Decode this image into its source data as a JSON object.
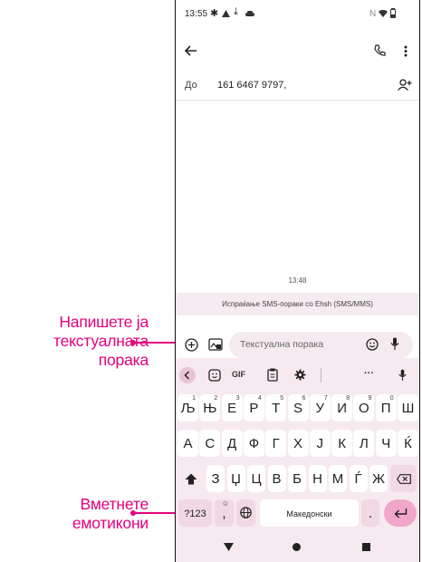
{
  "annotations": {
    "write_message": [
      "Напишете ја",
      "текстуалната",
      "порака"
    ],
    "insert_emoticons": [
      "Вметнете",
      "емотикони"
    ]
  },
  "status_bar": {
    "time": "13:55",
    "nfc": "N"
  },
  "app_bar": {
    "back_icon": "arrow-left-icon",
    "call_icon": "phone-icon",
    "more_icon": "more-vert-icon"
  },
  "recipient": {
    "label": "До",
    "number": "161 6467 9797,",
    "add_icon": "person-add-icon"
  },
  "conversation": {
    "timestamp": "13:48",
    "sending_via": "Испраќање SMS-пораки со Ehsh (SMS/MMS)"
  },
  "composer": {
    "placeholder": "Текстуална порака"
  },
  "keyboard": {
    "toolbar": {
      "gif": "GIF",
      "more": "···"
    },
    "row1": [
      {
        "k": "Љ",
        "h": "1"
      },
      {
        "k": "Њ",
        "h": "2"
      },
      {
        "k": "Е",
        "h": "3"
      },
      {
        "k": "Р",
        "h": "4"
      },
      {
        "k": "Т",
        "h": "5"
      },
      {
        "k": "Ѕ",
        "h": "6"
      },
      {
        "k": "У",
        "h": "7"
      },
      {
        "k": "И",
        "h": "8"
      },
      {
        "k": "О",
        "h": "9"
      },
      {
        "k": "П",
        "h": "0"
      },
      {
        "k": "Ш",
        "h": ""
      }
    ],
    "row2": [
      "А",
      "С",
      "Д",
      "Ф",
      "Г",
      "Х",
      "Ј",
      "К",
      "Л",
      "Ч",
      "Ќ"
    ],
    "row3": [
      "З",
      "Џ",
      "Ц",
      "В",
      "Б",
      "Н",
      "М",
      "Ѓ",
      "Ж"
    ],
    "symbols_key": "?123",
    "comma_key": ",",
    "space_label": "Македонски",
    "period_key": "."
  },
  "colors": {
    "accent": "#e5007e",
    "keyboard_bg": "#f7e9f0",
    "key_bg": "#ffffff",
    "function_key_bg": "#f1d9e4"
  }
}
